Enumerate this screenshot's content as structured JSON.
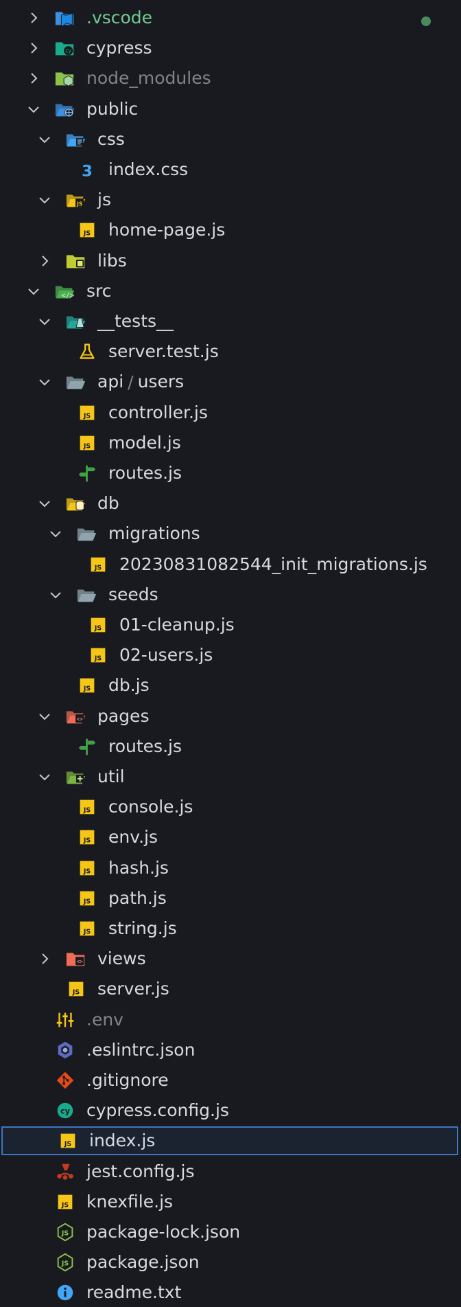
{
  "explorer": {
    "items": [
      {
        "label": ".vscode",
        "depth": 0,
        "kind": "folder",
        "state": "collapsed",
        "icon": "vscode-folder-icon",
        "color": "#3d8fe0",
        "style": "green",
        "modified_dot": true
      },
      {
        "label": "cypress",
        "depth": 0,
        "kind": "folder",
        "state": "collapsed",
        "icon": "cypress-folder-icon",
        "color": "#1aaa8c"
      },
      {
        "label": "node_modules",
        "depth": 0,
        "kind": "folder",
        "state": "collapsed",
        "icon": "node-folder-icon",
        "color": "#8bc34a",
        "style": "dim"
      },
      {
        "label": "public",
        "depth": 0,
        "kind": "folder",
        "state": "expanded",
        "icon": "public-folder-icon",
        "color": "#3d8fe0"
      },
      {
        "label": "css",
        "depth": 1,
        "kind": "folder",
        "state": "expanded",
        "icon": "css-folder-icon",
        "color": "#42a5f5"
      },
      {
        "label": "index.css",
        "depth": 2,
        "kind": "file",
        "icon": "css-file-icon",
        "color": "#42a5f5"
      },
      {
        "label": "js",
        "depth": 1,
        "kind": "folder",
        "state": "expanded",
        "icon": "js-folder-icon",
        "color": "#f5c518"
      },
      {
        "label": "home-page.js",
        "depth": 2,
        "kind": "file",
        "icon": "js-file-icon",
        "color": "#f5c518"
      },
      {
        "label": "libs",
        "depth": 1,
        "kind": "folder",
        "state": "collapsed",
        "icon": "libs-folder-icon",
        "color": "#c0ca33"
      },
      {
        "label": "src",
        "depth": 0,
        "kind": "folder",
        "state": "expanded",
        "icon": "src-folder-icon",
        "color": "#4caf50"
      },
      {
        "label": "__tests__",
        "depth": 1,
        "kind": "folder",
        "state": "expanded",
        "icon": "tests-folder-icon",
        "color": "#26a69a"
      },
      {
        "label": "server.test.js",
        "depth": 2,
        "kind": "file",
        "icon": "test-flask-icon",
        "color": "#f5c518"
      },
      {
        "label": "api",
        "label_suffix": "users",
        "depth": 1,
        "kind": "folder",
        "state": "expanded",
        "icon": "folder-open-icon",
        "color": "#90a4ae"
      },
      {
        "label": "controller.js",
        "depth": 2,
        "kind": "file",
        "icon": "js-file-icon",
        "color": "#f5c518"
      },
      {
        "label": "model.js",
        "depth": 2,
        "kind": "file",
        "icon": "js-file-icon",
        "color": "#f5c518"
      },
      {
        "label": "routes.js",
        "depth": 2,
        "kind": "file",
        "icon": "routes-signpost-icon",
        "color": "#43a047"
      },
      {
        "label": "db",
        "depth": 1,
        "kind": "folder",
        "state": "expanded",
        "icon": "db-folder-icon",
        "color": "#f5c518"
      },
      {
        "label": "migrations",
        "depth": 2,
        "kind": "folder",
        "state": "expanded",
        "icon": "folder-open-icon",
        "color": "#90a4ae"
      },
      {
        "label": "20230831082544_init_migrations.js",
        "depth": 3,
        "kind": "file",
        "icon": "js-file-icon",
        "color": "#f5c518"
      },
      {
        "label": "seeds",
        "depth": 2,
        "kind": "folder",
        "state": "expanded",
        "icon": "folder-open-icon",
        "color": "#90a4ae"
      },
      {
        "label": "01-cleanup.js",
        "depth": 3,
        "kind": "file",
        "icon": "js-file-icon",
        "color": "#f5c518"
      },
      {
        "label": "02-users.js",
        "depth": 3,
        "kind": "file",
        "icon": "js-file-icon",
        "color": "#f5c518"
      },
      {
        "label": "db.js",
        "depth": 2,
        "kind": "file",
        "icon": "js-file-icon",
        "color": "#f5c518"
      },
      {
        "label": "pages",
        "depth": 1,
        "kind": "folder",
        "state": "expanded",
        "icon": "pages-folder-icon",
        "color": "#ef6c57"
      },
      {
        "label": "routes.js",
        "depth": 2,
        "kind": "file",
        "icon": "routes-signpost-icon",
        "color": "#43a047"
      },
      {
        "label": "util",
        "depth": 1,
        "kind": "folder",
        "state": "expanded",
        "icon": "util-folder-icon",
        "color": "#7cb342"
      },
      {
        "label": "console.js",
        "depth": 2,
        "kind": "file",
        "icon": "js-file-icon",
        "color": "#f5c518"
      },
      {
        "label": "env.js",
        "depth": 2,
        "kind": "file",
        "icon": "js-file-icon",
        "color": "#f5c518"
      },
      {
        "label": "hash.js",
        "depth": 2,
        "kind": "file",
        "icon": "js-file-icon",
        "color": "#f5c518"
      },
      {
        "label": "path.js",
        "depth": 2,
        "kind": "file",
        "icon": "js-file-icon",
        "color": "#f5c518"
      },
      {
        "label": "string.js",
        "depth": 2,
        "kind": "file",
        "icon": "js-file-icon",
        "color": "#f5c518"
      },
      {
        "label": "views",
        "depth": 1,
        "kind": "folder",
        "state": "collapsed",
        "icon": "views-folder-icon",
        "color": "#ef6c57"
      },
      {
        "label": "server.js",
        "depth": 1,
        "kind": "file",
        "icon": "js-file-icon",
        "color": "#f5c518"
      },
      {
        "label": ".env",
        "depth": 0,
        "kind": "file",
        "icon": "env-sliders-icon",
        "color": "#f5c518",
        "style": "dim"
      },
      {
        "label": ".eslintrc.json",
        "depth": 0,
        "kind": "file",
        "icon": "eslint-icon",
        "color": "#5c6bc0"
      },
      {
        "label": ".gitignore",
        "depth": 0,
        "kind": "file",
        "icon": "git-icon",
        "color": "#e64a19"
      },
      {
        "label": "cypress.config.js",
        "depth": 0,
        "kind": "file",
        "icon": "cypress-icon",
        "color": "#1aaa8c"
      },
      {
        "label": "index.js",
        "depth": 0,
        "kind": "file",
        "icon": "js-file-icon",
        "color": "#f5c518",
        "selected": true
      },
      {
        "label": "jest.config.js",
        "depth": 0,
        "kind": "file",
        "icon": "jest-icon",
        "color": "#c23b22"
      },
      {
        "label": "knexfile.js",
        "depth": 0,
        "kind": "file",
        "icon": "js-file-icon",
        "color": "#f5c518"
      },
      {
        "label": "package-lock.json",
        "depth": 0,
        "kind": "file",
        "icon": "nodejs-icon",
        "color": "#8bc34a"
      },
      {
        "label": "package.json",
        "depth": 0,
        "kind": "file",
        "icon": "nodejs-icon",
        "color": "#8bc34a"
      },
      {
        "label": "readme.txt",
        "depth": 0,
        "kind": "file",
        "icon": "info-icon",
        "color": "#42a5f5"
      }
    ]
  }
}
